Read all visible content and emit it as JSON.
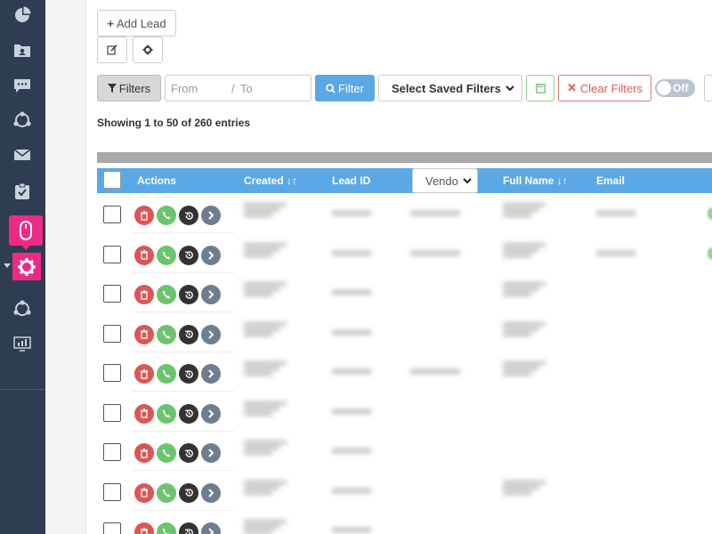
{
  "sidebar": {
    "icons": [
      "pie-chart-icon",
      "contacts-folder-icon",
      "chat-icon",
      "share-network-icon",
      "mail-icon",
      "checklist-icon",
      "mouse-icon",
      "gear-icon",
      "share-network-icon",
      "monitor-chart-icon"
    ],
    "active_color": "#ee2a85",
    "bg_color": "#2e3d52"
  },
  "toolbar": {
    "add_lead_label": "Add Lead",
    "filters_label": "Filters",
    "from_placeholder": "From",
    "to_placeholder": "To",
    "filter_button_label": "Filter",
    "saved_filters_label": "Select Saved Filters",
    "clear_filters_label": "Clear Filters",
    "toggle_label": "Off"
  },
  "table": {
    "showing_text": "Showing 1 to 50 of 260 entries",
    "columns": {
      "actions": "Actions",
      "created": "Created",
      "lead_id": "Lead ID",
      "vendor": "Vendo",
      "full_name": "Full Name",
      "email": "Email"
    },
    "header_color": "#5aa9e6",
    "rows": [
      {
        "created": "",
        "lead_id": "",
        "vendor": "",
        "full_name": "",
        "email": ""
      },
      {
        "created": "",
        "lead_id": "",
        "vendor": "",
        "full_name": "",
        "email": ""
      },
      {
        "created": "",
        "lead_id": "",
        "vendor": "",
        "full_name": "",
        "email": ""
      },
      {
        "created": "",
        "lead_id": "",
        "vendor": "",
        "full_name": "",
        "email": ""
      },
      {
        "created": "",
        "lead_id": "",
        "vendor": "",
        "full_name": "",
        "email": ""
      },
      {
        "created": "",
        "lead_id": "",
        "vendor": "",
        "full_name": "",
        "email": ""
      },
      {
        "created": "",
        "lead_id": "",
        "vendor": "",
        "full_name": "",
        "email": ""
      },
      {
        "created": "",
        "lead_id": "",
        "vendor": "",
        "full_name": "",
        "email": ""
      },
      {
        "created": "",
        "lead_id": "",
        "vendor": "",
        "full_name": "",
        "email": ""
      }
    ]
  }
}
